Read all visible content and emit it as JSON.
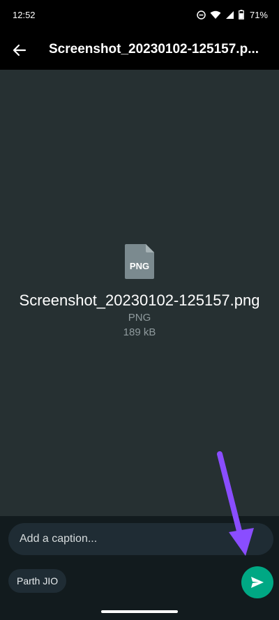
{
  "status_bar": {
    "time": "12:52",
    "battery": "71%",
    "icons": [
      "do-not-disturb-icon",
      "wifi-icon",
      "signal-icon",
      "battery-icon"
    ]
  },
  "app_bar": {
    "title": "Screenshot_20230102-125157.p...",
    "back_icon": "arrow-left-icon"
  },
  "preview": {
    "icon_label": "PNG",
    "file_name": "Screenshot_20230102-125157.png",
    "file_type": "PNG",
    "file_size": "189 kB"
  },
  "composer": {
    "caption_placeholder": "Add a caption...",
    "recipient": "Parth JIO",
    "send_icon": "send-icon"
  },
  "colors": {
    "background": "#000000",
    "preview_bg": "#263032",
    "bottom_bg": "#121b1e",
    "input_bg": "#1f2c34",
    "accent": "#00a884",
    "annotation": "#8a4dff"
  }
}
